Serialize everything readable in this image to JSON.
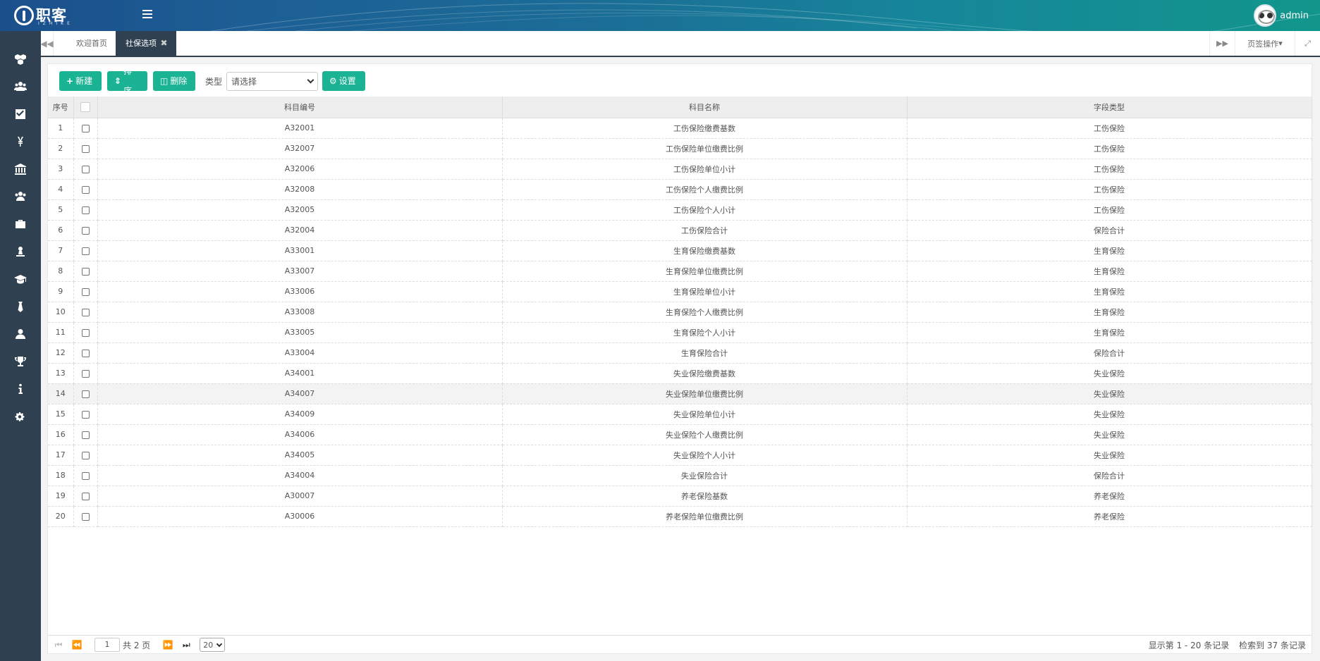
{
  "app": {
    "logo_text": "职客",
    "logo_sub": "IZHIKE",
    "user": "admin"
  },
  "sidebar": {
    "items": [
      {
        "icon": "cubes-icon"
      },
      {
        "icon": "users-icon"
      },
      {
        "icon": "check-square-icon"
      },
      {
        "icon": "yen-icon"
      },
      {
        "icon": "bank-icon"
      },
      {
        "icon": "group-icon"
      },
      {
        "icon": "briefcase-icon"
      },
      {
        "icon": "user-stamp-icon"
      },
      {
        "icon": "graduation-cap-icon"
      },
      {
        "icon": "tie-icon"
      },
      {
        "icon": "user-icon"
      },
      {
        "icon": "trophy-icon"
      },
      {
        "icon": "info-icon"
      },
      {
        "icon": "cogs-icon"
      }
    ]
  },
  "tabs": {
    "welcome": "欢迎首页",
    "active": "社保选项",
    "page_ops": "页签操作"
  },
  "toolbar": {
    "new_label": "新建",
    "sort_label": "排序",
    "delete_label": "删除",
    "type_label": "类型",
    "type_placeholder": "请选择",
    "settings_label": "设置"
  },
  "table": {
    "headers": {
      "index": "序号",
      "code": "科目编号",
      "name": "科目名称",
      "field_type": "字段类型"
    },
    "rows": [
      {
        "index": "1",
        "code": "A32001",
        "name": "工伤保险缴费基数",
        "type": "工伤保险"
      },
      {
        "index": "2",
        "code": "A32007",
        "name": "工伤保险单位缴费比例",
        "type": "工伤保险"
      },
      {
        "index": "3",
        "code": "A32006",
        "name": "工伤保险单位小计",
        "type": "工伤保险"
      },
      {
        "index": "4",
        "code": "A32008",
        "name": "工伤保险个人缴费比例",
        "type": "工伤保险"
      },
      {
        "index": "5",
        "code": "A32005",
        "name": "工伤保险个人小计",
        "type": "工伤保险"
      },
      {
        "index": "6",
        "code": "A32004",
        "name": "工伤保险合计",
        "type": "保险合计"
      },
      {
        "index": "7",
        "code": "A33001",
        "name": "生育保险缴费基数",
        "type": "生育保险"
      },
      {
        "index": "8",
        "code": "A33007",
        "name": "生育保险单位缴费比例",
        "type": "生育保险"
      },
      {
        "index": "9",
        "code": "A33006",
        "name": "生育保险单位小计",
        "type": "生育保险"
      },
      {
        "index": "10",
        "code": "A33008",
        "name": "生育保险个人缴费比例",
        "type": "生育保险"
      },
      {
        "index": "11",
        "code": "A33005",
        "name": "生育保险个人小计",
        "type": "生育保险"
      },
      {
        "index": "12",
        "code": "A33004",
        "name": "生育保险合计",
        "type": "保险合计"
      },
      {
        "index": "13",
        "code": "A34001",
        "name": "失业保险缴费基数",
        "type": "失业保险"
      },
      {
        "index": "14",
        "code": "A34007",
        "name": "失业保险单位缴费比例",
        "type": "失业保险"
      },
      {
        "index": "15",
        "code": "A34009",
        "name": "失业保险单位小计",
        "type": "失业保险"
      },
      {
        "index": "16",
        "code": "A34006",
        "name": "失业保险个人缴费比例",
        "type": "失业保险"
      },
      {
        "index": "17",
        "code": "A34005",
        "name": "失业保险个人小计",
        "type": "失业保险"
      },
      {
        "index": "18",
        "code": "A34004",
        "name": "失业保险合计",
        "type": "保险合计"
      },
      {
        "index": "19",
        "code": "A30007",
        "name": "养老保险基数",
        "type": "养老保险"
      },
      {
        "index": "20",
        "code": "A30006",
        "name": "养老保险单位缴费比例",
        "type": "养老保险"
      }
    ],
    "highlighted_row": 14
  },
  "pager": {
    "current_page": "1",
    "total_pages": "共 2 页",
    "page_size": "20",
    "showing": "显示第 1 - 20 条记录",
    "found": "检索到 37 条记录"
  },
  "colors": {
    "primary": "#1ab394",
    "sidebar": "#2f4050"
  }
}
